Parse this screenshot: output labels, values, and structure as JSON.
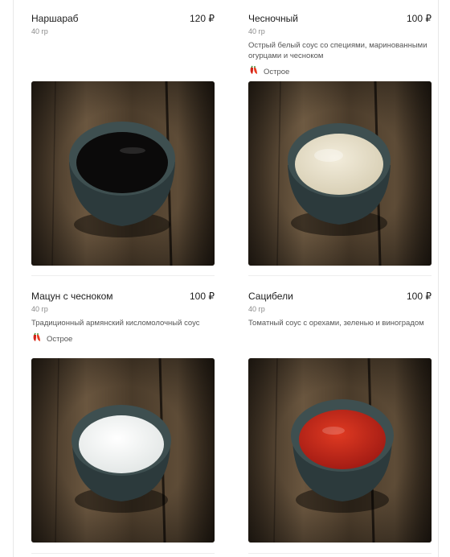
{
  "currency_symbol": "₽",
  "products": [
    {
      "name": "Наршараб",
      "price": "120 ₽",
      "weight": "40 гр",
      "description": "",
      "spicy_label": "",
      "sauce_color": "#0b0a0a"
    },
    {
      "name": "Чесночный",
      "price": "100 ₽",
      "weight": "40 гр",
      "description": "Острый белый соус со специями, маринованными огурцами и чесноком",
      "spicy_label": "Острое",
      "sauce_color": "#e9e2cf"
    },
    {
      "name": "Мацун с чесноком",
      "price": "100 ₽",
      "weight": "40 гр",
      "description": "Традиционный армянский кисломолочный соус",
      "spicy_label": "Острое",
      "sauce_color": "#f2f4f3"
    },
    {
      "name": "Сацибели",
      "price": "100 ₽",
      "weight": "40 гр",
      "description": "Томатный соус с орехами, зеленью и виноградом",
      "spicy_label": "",
      "sauce_color": "#c8281c"
    }
  ],
  "colors": {
    "wood_dark": "#2f2519",
    "wood_light": "#6a563f",
    "bowl": "#2c3a3c"
  },
  "icons": {
    "spicy": "chili-pepper-icon"
  }
}
